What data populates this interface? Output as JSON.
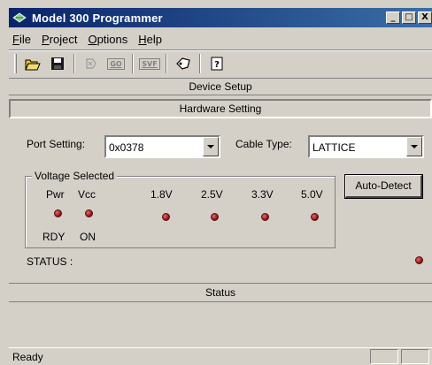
{
  "window": {
    "title": "Model 300 Programmer",
    "controls": {
      "minimize": "_",
      "maximize": "□",
      "close": "X"
    }
  },
  "menu": [
    {
      "label": "File",
      "accel": "F",
      "rest": "ile"
    },
    {
      "label": "Project",
      "accel": "P",
      "rest": "roject"
    },
    {
      "label": "Options",
      "accel": "O",
      "rest": "ptions"
    },
    {
      "label": "Help",
      "accel": "H",
      "rest": "elp"
    }
  ],
  "toolbar": {
    "icons": [
      "open-folder-icon",
      "save-disk-icon",
      "device-icon",
      "go-icon",
      "svf-icon",
      "tag-icon",
      "help-icon"
    ],
    "go_label": "GO",
    "svf_label": "SVF"
  },
  "sections": {
    "device_setup": "Device Setup",
    "hardware_setting": "Hardware Setting",
    "status": "Status"
  },
  "port": {
    "label": "Port Setting:",
    "value": "0x0378"
  },
  "cable": {
    "label": "Cable Type:",
    "value": "LATTICE"
  },
  "voltage": {
    "title": "Voltage Selected",
    "pwr_label": "Pwr",
    "vcc_label": "Vcc",
    "rdy_label": "RDY",
    "on_label": "ON",
    "levels": [
      "1.8V",
      "2.5V",
      "3.3V",
      "5.0V"
    ]
  },
  "auto_detect_label": "Auto-Detect",
  "status_label": "STATUS :",
  "statusbar_text": "Ready",
  "colors": {
    "title_start": "#0a246a",
    "title_end": "#3a6ea5",
    "led": "#8a0b0b",
    "face": "#d4d0c8"
  }
}
